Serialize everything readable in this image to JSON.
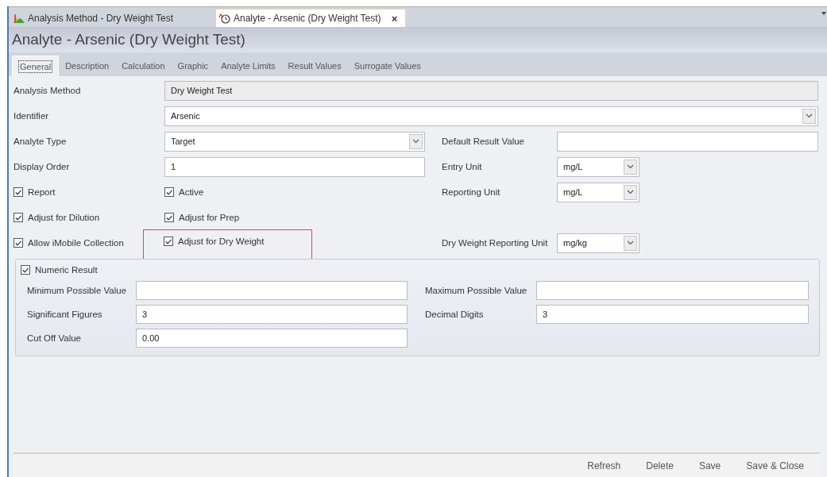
{
  "document_tabs": [
    {
      "label": "Analysis Method - Dry Weight Test",
      "selected": false
    },
    {
      "label": "Analyte - Arsenic (Dry Weight Test)",
      "selected": true,
      "close": "×"
    }
  ],
  "page_title": "Analyte - Arsenic (Dry Weight Test)",
  "tabs": [
    {
      "label": "General",
      "selected": true
    },
    {
      "label": "Description",
      "selected": false
    },
    {
      "label": "Calculation",
      "selected": false
    },
    {
      "label": "Graphic",
      "selected": false
    },
    {
      "label": "Analyte Limits",
      "selected": false
    },
    {
      "label": "Result Values",
      "selected": false
    },
    {
      "label": "Surrogate Values",
      "selected": false
    }
  ],
  "form_rows": [
    [
      {
        "kind": "wide_readonly",
        "label": "Analysis Method",
        "value": "Dry Weight Test"
      }
    ],
    [
      {
        "kind": "wide_combo",
        "label": "Identifier",
        "value": "Arsenic"
      }
    ],
    [
      {
        "kind": "combo",
        "label": "Analyte Type",
        "value": "Target"
      },
      {
        "kind": "text",
        "label": "Default Result Value"
      }
    ],
    [
      {
        "kind": "text",
        "label": "Display Order",
        "value": "1"
      },
      {
        "kind": "unit",
        "label": "Entry Unit",
        "value": "mg/L"
      }
    ],
    [
      {
        "kind": "check",
        "label": "Report",
        "checked": true,
        "highlighted": false
      },
      {
        "kind": "check",
        "label": "Active",
        "checked": true,
        "highlighted": false
      },
      {
        "kind": "unit",
        "label": "Reporting Unit",
        "value": "mg/L"
      }
    ],
    [
      {
        "kind": "check",
        "label": "Adjust for Dilution",
        "checked": true,
        "highlighted": false
      },
      {
        "kind": "check",
        "label": "Adjust for Prep",
        "checked": true,
        "highlighted": false
      }
    ],
    [
      {
        "kind": "check",
        "label": "Allow iMobile Collection",
        "checked": true,
        "highlighted": false
      },
      {
        "kind": "check",
        "label": "Adjust for Dry Weight",
        "checked": true,
        "highlighted": true
      },
      {
        "kind": "unit",
        "label": "Dry Weight Reporting Unit",
        "value": "mg/kg"
      }
    ]
  ],
  "numeric_group": {
    "label": "Numeric Result",
    "checked": true,
    "rows": [
      [
        {
          "label": "Minimum Possible Value"
        },
        {
          "label": "Maximum Possible Value"
        }
      ],
      [
        {
          "label": "Significant Figures",
          "value": "3"
        },
        {
          "label": "Decimal Digits",
          "value": "3"
        }
      ],
      [
        {
          "label": "Cut Off Value",
          "value": "0.00"
        }
      ]
    ]
  },
  "footer_buttons": [
    "Refresh",
    "Delete",
    "Save",
    "Save & Close"
  ]
}
